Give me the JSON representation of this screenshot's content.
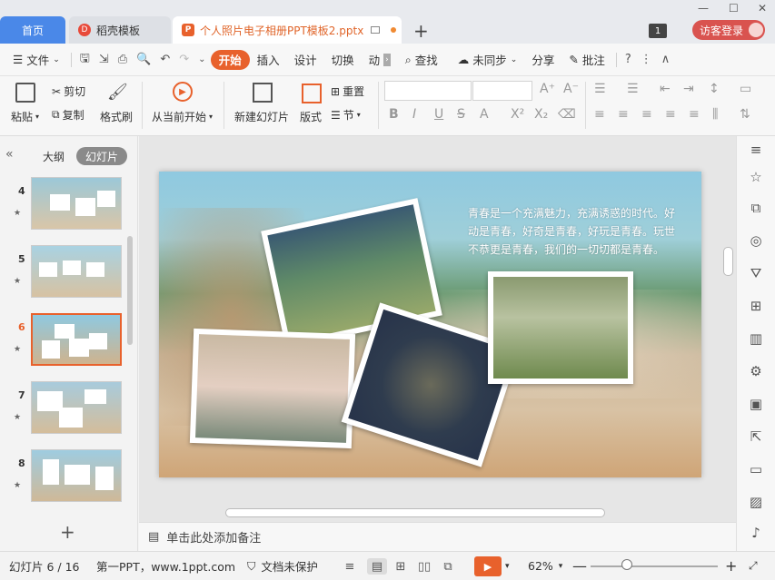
{
  "titlebar": {
    "home_tab": "首页",
    "dao_tab": "稻壳模板",
    "dao_icon": "D",
    "file_tab": "个人照片电子相册PPT模板2.pptx",
    "add_tab": "+",
    "window_badge": "1",
    "guest_login": "访客登录"
  },
  "menu": {
    "file": "文件",
    "start": "开始",
    "insert": "插入",
    "design": "设计",
    "switch": "切换",
    "animation": "动",
    "search": "查找",
    "unsynced": "未同步",
    "share": "分享",
    "annotate": "批注"
  },
  "ribbon": {
    "paste": "粘贴",
    "cut": "剪切",
    "copy": "复制",
    "format_painter": "格式刷",
    "from_start": "从当前开始",
    "new_slide": "新建幻灯片",
    "layout": "版式",
    "reset": "重置",
    "section": "节"
  },
  "leftpane": {
    "outline_tab": "大纲",
    "slides_tab": "幻灯片",
    "collapse": "«",
    "add_slide": "+",
    "thumbnails": [
      {
        "num": "4",
        "star": "★"
      },
      {
        "num": "5",
        "star": "★"
      },
      {
        "num": "6",
        "star": "★"
      },
      {
        "num": "7",
        "star": "★"
      },
      {
        "num": "8",
        "star": "★"
      }
    ]
  },
  "slide": {
    "text": "青春是一个充满魅力，充满诱惑的时代。好动是青春，好奇是青春，好玩是青春。玩世不恭更是青春，我们的一切切都是青春。"
  },
  "notes": {
    "placeholder": "单击此处添加备注"
  },
  "status": {
    "slide_count": "幻灯片 6 / 16",
    "source": "第一PPT，www.1ppt.com",
    "protection": "文档未保护",
    "zoom": "62%"
  },
  "colors": {
    "accent": "#e8612c",
    "home_tab": "#4a88e8",
    "guest": "#d9534f"
  }
}
